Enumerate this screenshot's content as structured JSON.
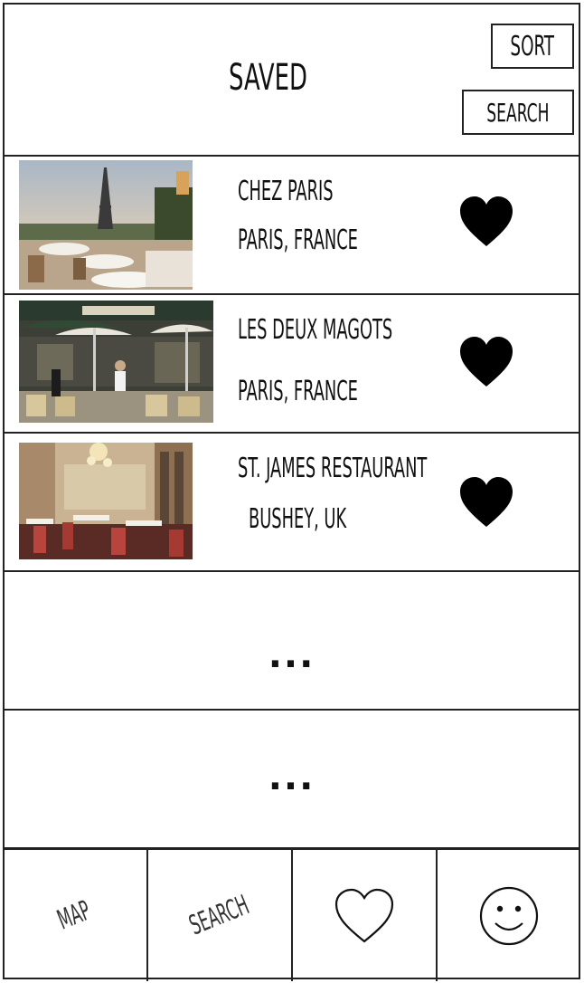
{
  "header": {
    "title": "SAVED",
    "sort_label": "SORT",
    "search_label": "SEARCH"
  },
  "items": [
    {
      "name": "CHEZ PARIS",
      "location": "PARIS, FRANCE",
      "favorite": true,
      "thumbnail": "eiffel-tower-terrace-photo"
    },
    {
      "name": "LES DEUX MAGOTS",
      "location": "PARIS, FRANCE",
      "favorite": true,
      "thumbnail": "cafe-terrace-photo"
    },
    {
      "name": "ST. JAMES RESTAURANT",
      "location": "BUSHEY, UK",
      "favorite": true,
      "thumbnail": "restaurant-interior-photo"
    }
  ],
  "placeholders": [
    "...",
    "..."
  ],
  "nav": {
    "map_label": "MAP",
    "search_label": "SEARCH",
    "saved_icon": "heart-outline-icon",
    "profile_icon": "smiley-face-icon"
  },
  "colors": {
    "line": "#222222",
    "heart": "#000000"
  }
}
